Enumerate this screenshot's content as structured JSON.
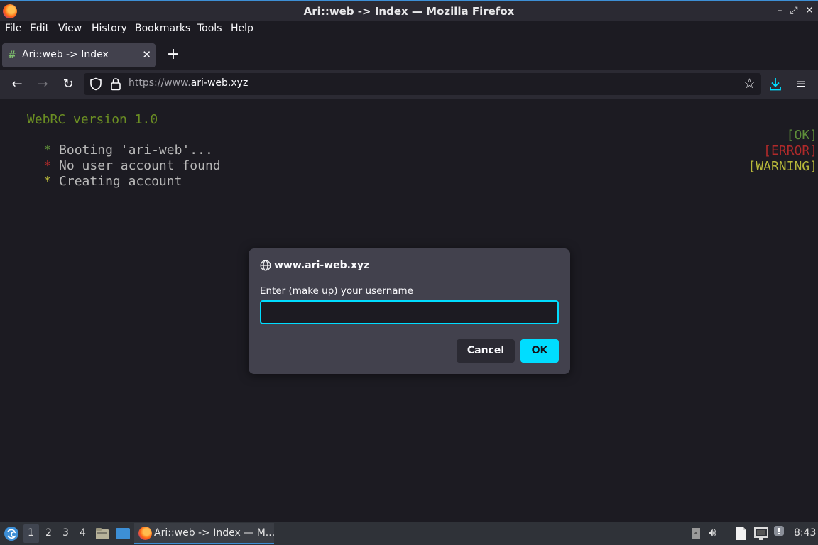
{
  "window": {
    "title": "Ari::web -> Index — Mozilla Firefox"
  },
  "menubar": {
    "items": [
      "File",
      "Edit",
      "View",
      "History",
      "Bookmarks",
      "Tools",
      "Help"
    ]
  },
  "tab": {
    "label": "Ari::web -> Index",
    "favicon": "hash-icon"
  },
  "urlbar": {
    "prefix": "https://www.",
    "host": "ari-web.xyz"
  },
  "terminal": {
    "header": "WebRC version 1.0",
    "lines": [
      {
        "bullet": "*",
        "text": "Booting 'ari-web'...",
        "status": "[OK]"
      },
      {
        "bullet": "*",
        "text": "No user account found",
        "status": "[ERROR]"
      },
      {
        "bullet": "*",
        "text": "Creating account",
        "status": "[WARNING]"
      }
    ]
  },
  "dialog": {
    "origin": "www.ari-web.xyz",
    "prompt": "Enter (make up) your username",
    "input_value": "",
    "cancel_label": "Cancel",
    "ok_label": "OK"
  },
  "taskbar": {
    "workspaces": [
      "1",
      "2",
      "3",
      "4"
    ],
    "active_workspace": "1",
    "task_label": "Ari::web -> Index — M...",
    "clock": "8:43"
  },
  "colors": {
    "accent": "#00ddff",
    "ok": "#5f8f3a",
    "error": "#b02a2a",
    "warning": "#b8b83a",
    "header_green": "#6b8e23"
  }
}
